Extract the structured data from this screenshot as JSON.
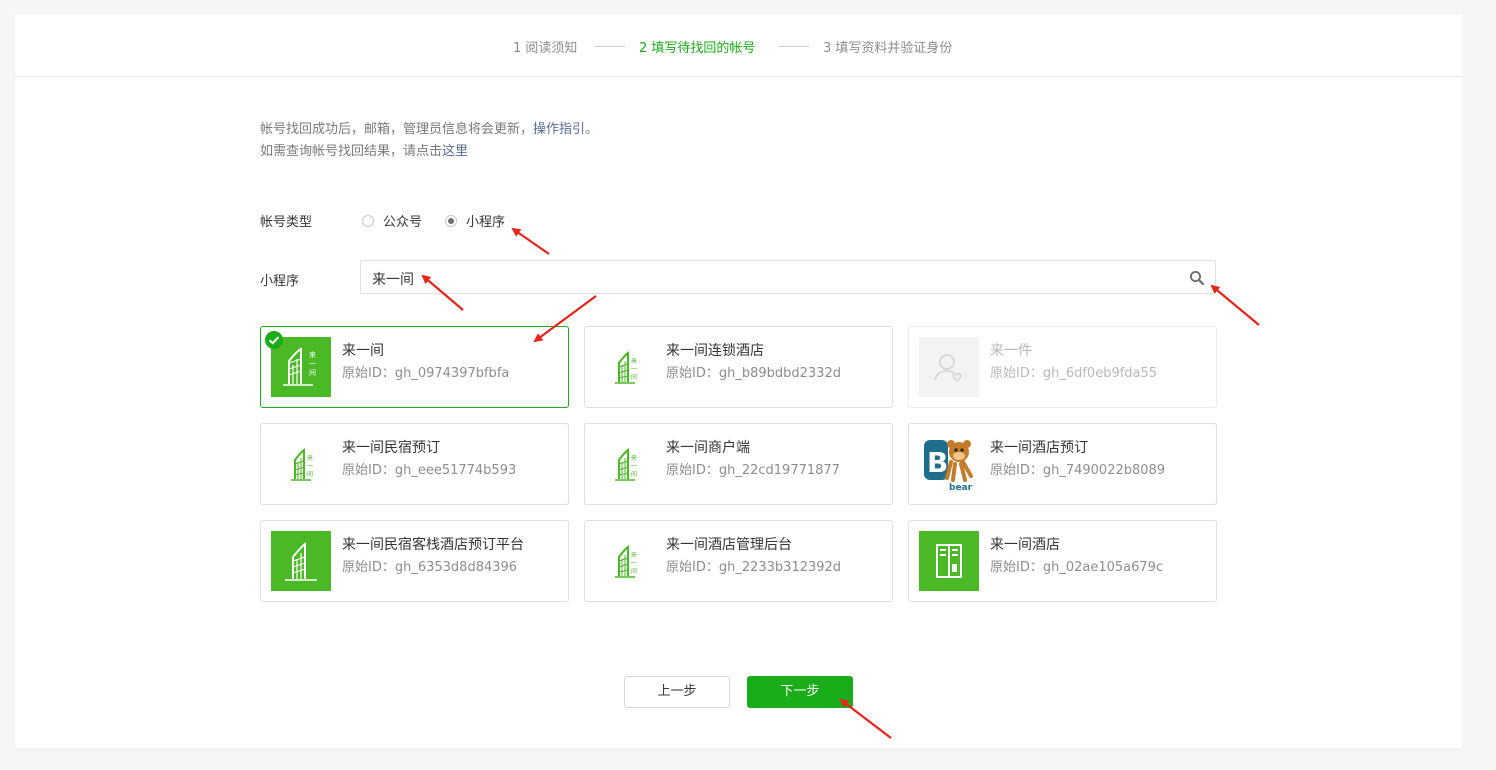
{
  "steps": {
    "step1": "1 阅读须知",
    "step2": "2 填写待找回的帐号",
    "step3": "3 填写资料并验证身份"
  },
  "notice": {
    "line1": "帐号找回成功后，邮箱，管理员信息将会更新，",
    "line1_link": "操作指引",
    "line1_end": "。",
    "line2": "如需查询帐号找回结果，请点击",
    "line2_link": "这里"
  },
  "account_type": {
    "label": "帐号类型",
    "options": [
      "公众号",
      "小程序"
    ],
    "selected": "小程序"
  },
  "search": {
    "label": "小程序",
    "value": "来一间"
  },
  "results": [
    {
      "name": "来一间",
      "id_label": "原始ID：gh_0974397bfbfa",
      "selected": true,
      "disabled": false,
      "icon": "green-sail-logo"
    },
    {
      "name": "来一间连锁酒店",
      "id_label": "原始ID：gh_b89bdbd2332d",
      "selected": false,
      "disabled": false,
      "icon": "white-sail-logo"
    },
    {
      "name": "来一件",
      "id_label": "原始ID：gh_6df0eb9fda55",
      "selected": false,
      "disabled": true,
      "icon": "default-avatar"
    },
    {
      "name": "来一间民宿预订",
      "id_label": "原始ID：gh_eee51774b593",
      "selected": false,
      "disabled": false,
      "icon": "white-sail-logo"
    },
    {
      "name": "来一间商户端",
      "id_label": "原始ID：gh_22cd19771877",
      "selected": false,
      "disabled": false,
      "icon": "white-sail-logo"
    },
    {
      "name": "来一间酒店预订",
      "id_label": "原始ID：gh_7490022b8089",
      "selected": false,
      "disabled": false,
      "icon": "bear-logo"
    },
    {
      "name": "来一间民宿客栈酒店预订平台",
      "id_label": "原始ID：gh_6353d8d84396",
      "selected": false,
      "disabled": false,
      "icon": "green-sail-logo"
    },
    {
      "name": "来一间酒店管理后台",
      "id_label": "原始ID：gh_2233b312392d",
      "selected": false,
      "disabled": false,
      "icon": "white-sail-logo"
    },
    {
      "name": "来一间酒店",
      "id_label": "原始ID：gh_02ae105a679c",
      "selected": false,
      "disabled": false,
      "icon": "green-door-logo"
    }
  ],
  "bear_text": "bear",
  "buttons": {
    "prev": "上一步",
    "next": "下一步"
  },
  "colors": {
    "accent": "#1aad19",
    "link": "#576b95",
    "annotation_arrow": "#e8231a"
  }
}
